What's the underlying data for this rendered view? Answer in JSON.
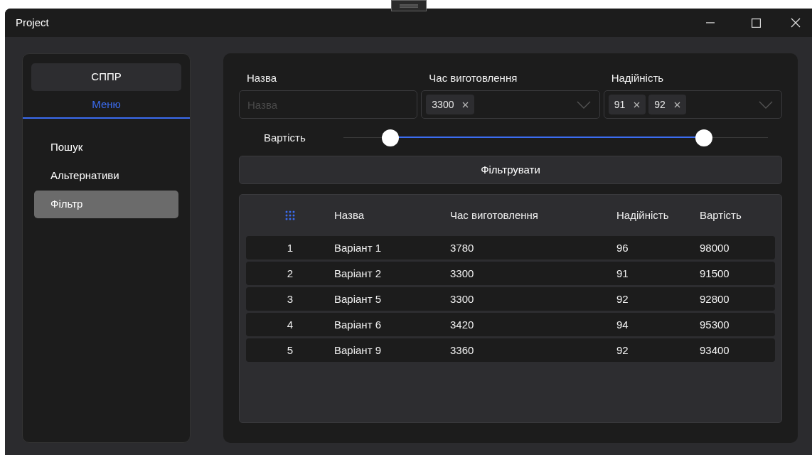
{
  "window": {
    "title": "Project"
  },
  "sidebar": {
    "header_button": "СППР",
    "tab": {
      "label": "Меню",
      "selected": true
    },
    "items": [
      {
        "label": "Пошук",
        "selected": false
      },
      {
        "label": "Альтернативи",
        "selected": false
      },
      {
        "label": "Фільтр",
        "selected": true
      }
    ]
  },
  "filters": {
    "name": {
      "label": "Назва",
      "placeholder": "Назва"
    },
    "time": {
      "label": "Час виготовлення",
      "chips": [
        "3300"
      ]
    },
    "reliability": {
      "label": "Надійність",
      "chips": [
        "91",
        "92"
      ]
    },
    "cost": {
      "label": "Вартість",
      "thumbs": [
        {
          "level": 0.11
        },
        {
          "level": 0.85
        }
      ]
    },
    "button": "Фільтрувати"
  },
  "table": {
    "columns": [
      "",
      "Назва",
      "Час виготовлення",
      "Надійність",
      "Вартість"
    ],
    "rows": [
      [
        "1",
        "Варіант 1",
        "3780",
        "96",
        "98000"
      ],
      [
        "2",
        "Варіант 2",
        "3300",
        "91",
        "91500"
      ],
      [
        "3",
        "Варіант 5",
        "3300",
        "92",
        "92800"
      ],
      [
        "4",
        "Варіант 6",
        "3420",
        "94",
        "95300"
      ],
      [
        "5",
        "Варіант 9",
        "3360",
        "92",
        "93400"
      ]
    ]
  }
}
